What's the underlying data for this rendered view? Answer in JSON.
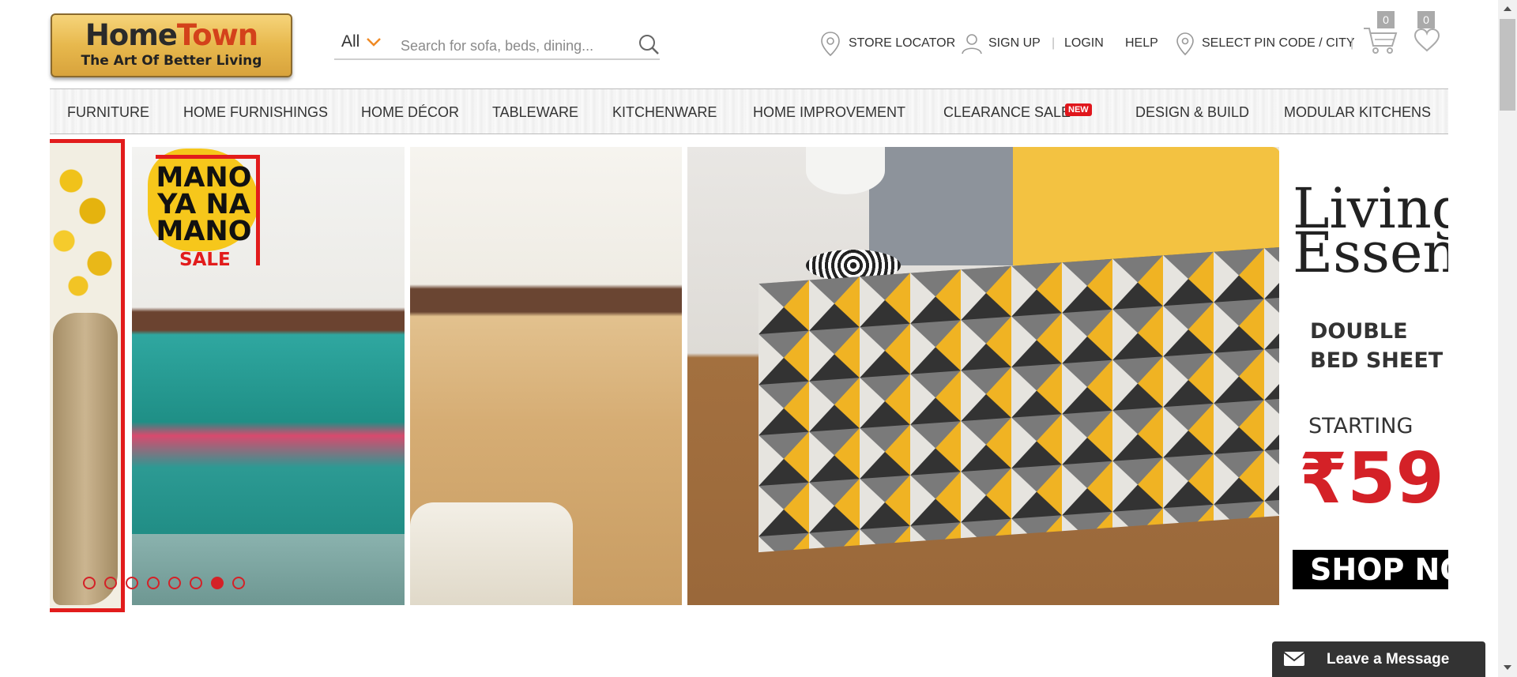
{
  "logo": {
    "home": "Home",
    "town": "Town",
    "tagline": "The Art Of Better Living"
  },
  "search": {
    "category": "All",
    "placeholder": "Search for sofa, beds, dining..."
  },
  "toplinks": {
    "store_locator": "STORE LOCATOR",
    "sign_up": "SIGN UP",
    "login": "LOGIN",
    "help": "HELP",
    "pincode": "SELECT PIN CODE / CITY",
    "separator": "|"
  },
  "cart_count": "0",
  "wishlist_count": "0",
  "nav": [
    {
      "label": "FURNITURE"
    },
    {
      "label": "HOME FURNISHINGS"
    },
    {
      "label": "HOME DÉCOR"
    },
    {
      "label": "TABLEWARE"
    },
    {
      "label": "KITCHENWARE"
    },
    {
      "label": "HOME IMPROVEMENT"
    },
    {
      "label": "CLEARANCE SALE"
    },
    {
      "label": "DESIGN & BUILD"
    },
    {
      "label": "MODULAR KITCHENS"
    }
  ],
  "nav_new_tag": "NEW",
  "banner": {
    "sale_badge": "MANO\nYA NA\nMANO",
    "sale_tag": "SALE",
    "promo_title": "Living\nEssenc",
    "promo_subtitle": "DOUBLE\nBED SHEET",
    "promo_starting": "STARTING",
    "promo_price": "₹59",
    "promo_cta": "SHOP NO",
    "slides_total": 8,
    "active_slide": 7
  },
  "chat": {
    "label": "Leave a Message"
  },
  "colors": {
    "accent": "#d42127",
    "brand_orange": "#d3421b",
    "nav_text": "#333333"
  }
}
